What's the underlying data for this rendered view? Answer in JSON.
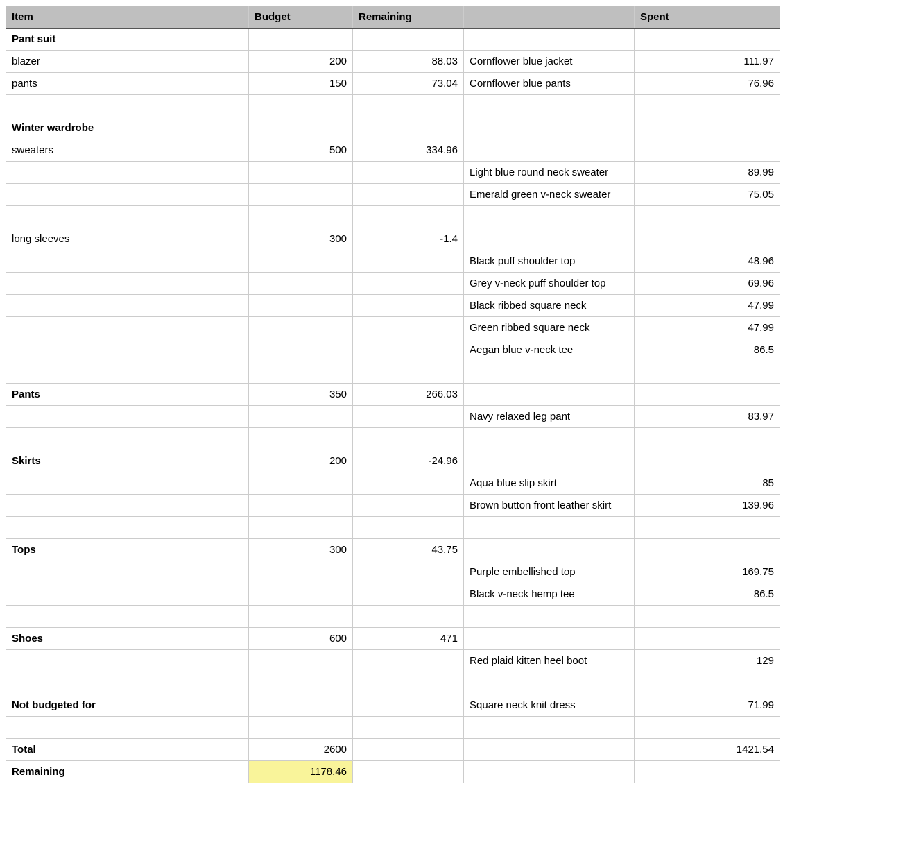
{
  "headers": {
    "item": "Item",
    "budget": "Budget",
    "remaining": "Remaining",
    "desc": "",
    "spent": "Spent"
  },
  "rows": [
    {
      "item": "Pant suit",
      "bold": true
    },
    {
      "item": "blazer",
      "budget": "200",
      "remaining": "88.03",
      "desc": "Cornflower blue jacket",
      "spent": "111.97"
    },
    {
      "item": "pants",
      "budget": "150",
      "remaining": "73.04",
      "desc": "Cornflower blue pants",
      "spent": "76.96"
    },
    {},
    {
      "item": "Winter wardrobe",
      "bold": true
    },
    {
      "item": "sweaters",
      "budget": "500",
      "remaining": "334.96"
    },
    {
      "desc": "Light blue round neck sweater",
      "spent": "89.99"
    },
    {
      "desc": "Emerald green v-neck sweater",
      "spent": "75.05"
    },
    {},
    {
      "item": "long sleeves",
      "budget": "300",
      "remaining": "-1.4"
    },
    {
      "desc": "Black puff shoulder top",
      "spent": "48.96"
    },
    {
      "desc": "Grey v-neck puff shoulder top",
      "spent": "69.96"
    },
    {
      "desc": "Black ribbed square neck",
      "spent": "47.99"
    },
    {
      "desc": "Green ribbed square neck",
      "spent": "47.99"
    },
    {
      "desc": "Aegan blue v-neck tee",
      "spent": "86.5"
    },
    {},
    {
      "item": "Pants",
      "bold": true,
      "budget": "350",
      "remaining": "266.03"
    },
    {
      "desc": "Navy relaxed leg pant",
      "spent": "83.97"
    },
    {},
    {
      "item": "Skirts",
      "bold": true,
      "budget": "200",
      "remaining": "-24.96"
    },
    {
      "desc": "Aqua blue slip skirt",
      "spent": "85"
    },
    {
      "desc": "Brown button front leather skirt",
      "spent": "139.96"
    },
    {},
    {
      "item": "Tops",
      "bold": true,
      "budget": "300",
      "remaining": "43.75"
    },
    {
      "desc": "Purple embellished top",
      "spent": "169.75"
    },
    {
      "desc": "Black v-neck hemp tee",
      "spent": "86.5"
    },
    {},
    {
      "item": "Shoes",
      "bold": true,
      "budget": "600",
      "remaining": "471"
    },
    {
      "desc": "Red plaid kitten heel boot",
      "spent": "129"
    },
    {},
    {
      "item": "Not budgeted for",
      "bold": true,
      "desc": "Square neck knit dress",
      "spent": "71.99"
    },
    {},
    {
      "item": "Total",
      "bold": true,
      "budget": "2600",
      "spent": "1421.54"
    },
    {
      "item": "Remaining",
      "bold": true,
      "budget": "1178.46",
      "highlightBudget": true
    }
  ]
}
